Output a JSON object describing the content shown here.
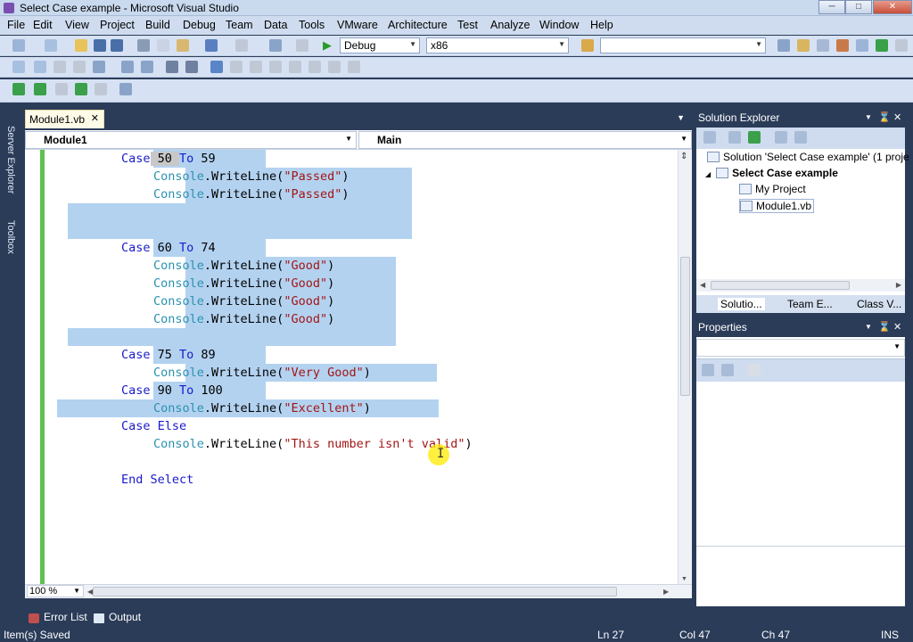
{
  "window": {
    "title": "Select Case example - Microsoft Visual Studio"
  },
  "menu": [
    "File",
    "Edit",
    "View",
    "Project",
    "Build",
    "Debug",
    "Team",
    "Data",
    "Tools",
    "VMware",
    "Architecture",
    "Test",
    "Analyze",
    "Window",
    "Help"
  ],
  "toolbar": {
    "config": "Debug",
    "platform": "x86",
    "find_value": ""
  },
  "sidebar_tabs": [
    "Server Explorer",
    "Toolbox"
  ],
  "document": {
    "tab": "Module1.vb",
    "nav_left": "Module1",
    "nav_right": "Main",
    "code_lines": [
      {
        "indent": 8,
        "kw1": "Case",
        "mid": " 50 ",
        "kw2": "To",
        "end": " 59"
      },
      {
        "indent": 12,
        "call": "Console",
        "method": ".WriteLine(",
        "str": "\"Passed\"",
        "close": ")"
      },
      {
        "indent": 12,
        "call": "Console",
        "method": ".WriteLine(",
        "str": "\"Passed\"",
        "close": ")"
      },
      {
        "blank": true
      },
      {
        "blank": true
      },
      {
        "indent": 8,
        "kw1": "Case",
        "mid": " 60 ",
        "kw2": "To",
        "end": " 74"
      },
      {
        "indent": 12,
        "call": "Console",
        "method": ".WriteLine(",
        "str": "\"Good\"",
        "close": ")"
      },
      {
        "indent": 12,
        "call": "Console",
        "method": ".WriteLine(",
        "str": "\"Good\"",
        "close": ")"
      },
      {
        "indent": 12,
        "call": "Console",
        "method": ".WriteLine(",
        "str": "\"Good\"",
        "close": ")"
      },
      {
        "indent": 12,
        "call": "Console",
        "method": ".WriteLine(",
        "str": "\"Good\"",
        "close": ")"
      },
      {
        "blank": true
      },
      {
        "indent": 8,
        "kw1": "Case",
        "mid": " 75 ",
        "kw2": "To",
        "end": " 89"
      },
      {
        "indent": 12,
        "call": "Console",
        "method": ".WriteLine(",
        "str": "\"Very Good\"",
        "close": ")"
      },
      {
        "indent": 8,
        "kw1": "Case",
        "mid": " 90 ",
        "kw2": "To",
        "end": " 100"
      },
      {
        "indent": 12,
        "call": "Console",
        "method": ".WriteLine(",
        "str": "\"Excellent\"",
        "close": ")"
      },
      {
        "indent": 8,
        "kw1": "Case",
        "mid": " ",
        "kw2": "Else",
        "end": ""
      },
      {
        "indent": 12,
        "call": "Console",
        "method": ".WriteLine(",
        "str": "\"This number isn't valid\"",
        "close": ")"
      },
      {
        "blank": true
      },
      {
        "indent": 8,
        "kw1": "End",
        "mid": " ",
        "kw2": "Select",
        "end": ""
      }
    ],
    "zoom": "100 %"
  },
  "bottom_tabs": [
    "Error List",
    "Output"
  ],
  "status": {
    "message": "Item(s) Saved",
    "ln": "Ln 27",
    "col": "Col 47",
    "ch": "Ch 47",
    "mode": "INS"
  },
  "solution_explorer": {
    "title": "Solution Explorer",
    "items": [
      {
        "label": "Solution 'Select Case example' (1 proje",
        "level": 0,
        "bold": false
      },
      {
        "label": "Select Case example",
        "level": 1,
        "bold": true
      },
      {
        "label": "My Project",
        "level": 2,
        "bold": false
      },
      {
        "label": "Module1.vb",
        "level": 2,
        "bold": false
      }
    ],
    "tabs": [
      "Solutio...",
      "Team E...",
      "Class V..."
    ]
  },
  "properties": {
    "title": "Properties",
    "object": ""
  },
  "colors": {
    "chrome": "#2b3c59",
    "selection": "#b3d2f0",
    "keyword": "#1a1acc",
    "string": "#a31515",
    "type": "#2b91af",
    "margin": "#60c050"
  }
}
